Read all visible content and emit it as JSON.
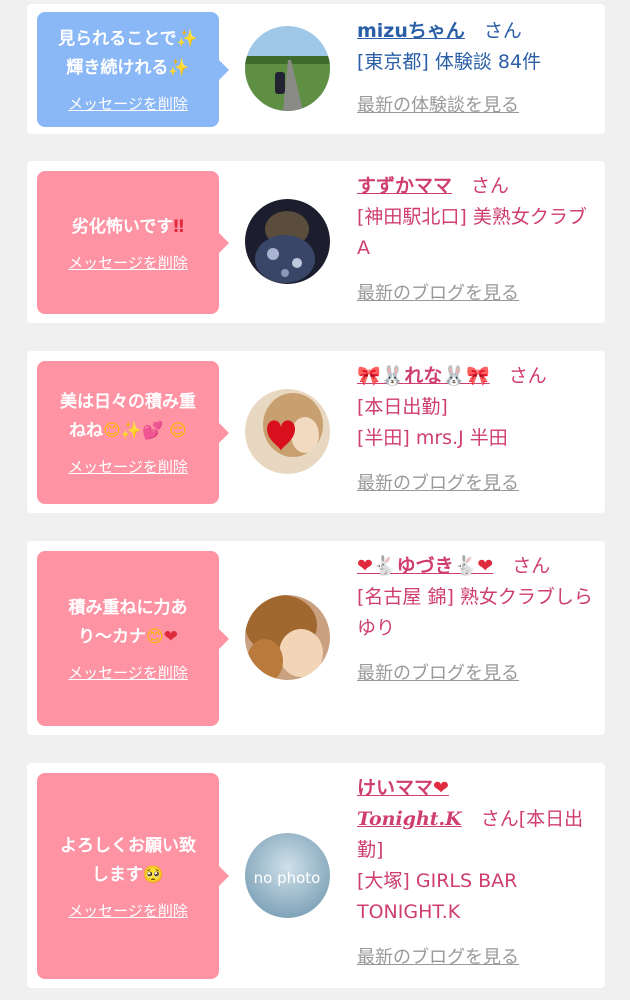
{
  "cards": [
    {
      "message_text": "見られることで✨輝き続けれる✨",
      "delete_label": "メッセージを削除",
      "name": "mizuちゃん",
      "san": "さん",
      "lines": [
        "[東京都] 体験談 84件"
      ],
      "more_link": "最新の体験談を見る"
    },
    {
      "message_text": "劣化怖いです‼️",
      "delete_label": "メッセージを削除",
      "name": "すずかママ",
      "san": "さん",
      "lines": [
        "[神田駅北口] 美熟女クラブA"
      ],
      "more_link": "最新のブログを見る"
    },
    {
      "message_text": "美は日々の積み重ねね🥰✨💕😌",
      "delete_label": "メッセージを削除",
      "name": "🎀🐰れな🐰🎀",
      "san": "さん",
      "lines": [
        "[本日出勤]",
        "[半田] mrs.J 半田"
      ],
      "more_link": "最新のブログを見る"
    },
    {
      "message_text": "積み重ねに力あり〜カナ😊❤️",
      "delete_label": "メッセージを削除",
      "name": "❤️🐇ゆづき🐇❤️",
      "san": "さん",
      "lines": [
        "[名古屋 錦] 熟女クラブしらゆり"
      ],
      "more_link": "最新のブログを見る"
    },
    {
      "message_text": "よろしくお願い致します🥺",
      "delete_label": "メッセージを削除",
      "name": "けいママ❤️",
      "name_sub": "Tonight.K",
      "san": "さん[本日出勤]",
      "lines": [
        "[大塚] GIRLS BAR TONIGHT.K"
      ],
      "more_link": "最新のブログを見る",
      "avatar_text": "no photo"
    }
  ]
}
